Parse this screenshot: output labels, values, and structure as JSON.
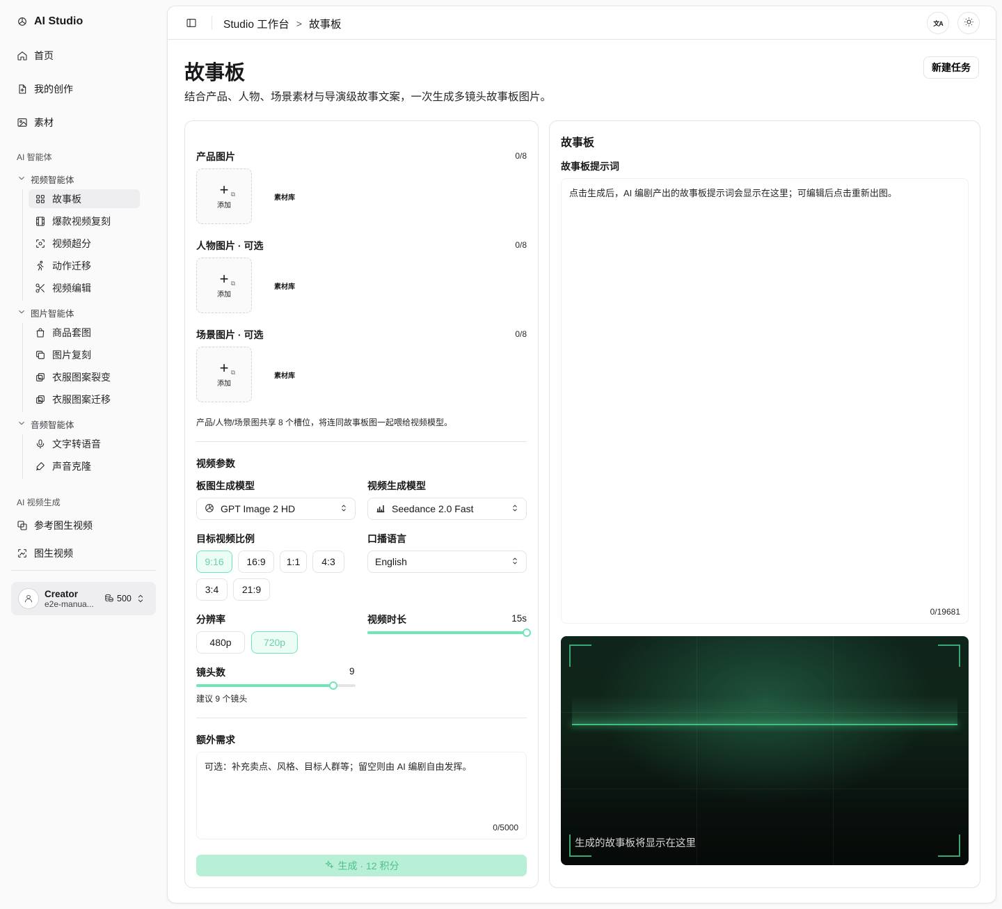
{
  "app": {
    "name": "AI Studio"
  },
  "nav": {
    "home": "首页",
    "my_creations": "我的创作",
    "assets": "素材"
  },
  "sections": {
    "ai_agents": "AI 智能体",
    "ai_video": "AI 视频生成"
  },
  "groups": {
    "video": {
      "label": "视频智能体",
      "items": [
        "故事板",
        "爆款视频复刻",
        "视频超分",
        "动作迁移",
        "视频编辑"
      ]
    },
    "image": {
      "label": "图片智能体",
      "items": [
        "商品套图",
        "图片复刻",
        "衣服图案裂变",
        "衣服图案迁移"
      ]
    },
    "audio": {
      "label": "音频智能体",
      "items": [
        "文字转语音",
        "声音克隆"
      ]
    }
  },
  "video_gen": {
    "items": [
      "参考图生视频",
      "图生视频"
    ]
  },
  "user": {
    "name": "Creator",
    "email": "e2e-manua...",
    "credits": "500"
  },
  "header": {
    "breadcrumb_root": "Studio 工作台",
    "breadcrumb_sep": ">",
    "breadcrumb_current": "故事板",
    "lang_icon_text": "文A"
  },
  "page": {
    "title": "故事板",
    "subtitle": "结合产品、人物、场景素材与导演级故事文案，一次生成多镜头故事板图片。",
    "new_task": "新建任务"
  },
  "form": {
    "product": {
      "label": "产品图片",
      "count": "0/8"
    },
    "person": {
      "label": "人物图片 · 可选",
      "count": "0/8"
    },
    "scene": {
      "label": "场景图片 · 可选",
      "count": "0/8"
    },
    "add_label": "添加",
    "library_label": "素材库",
    "slots_note": "产品/人物/场景图共享 8 个槽位，将连同故事板图一起喂给视频模型。",
    "video_params": "视频参数",
    "board_model_label": "板图生成模型",
    "board_model_value": "GPT Image 2 HD",
    "video_model_label": "视频生成模型",
    "video_model_value": "Seedance 2.0 Fast",
    "ratio_label": "目标视频比例",
    "ratios": [
      "9:16",
      "16:9",
      "1:1",
      "4:3",
      "3:4",
      "21:9"
    ],
    "ratio_selected": "9:16",
    "language_label": "口播语言",
    "language_value": "English",
    "resolution_label": "分辨率",
    "resolutions": [
      "480p",
      "720p"
    ],
    "resolution_selected": "720p",
    "duration_label": "视频时长",
    "duration_value": "15s",
    "duration_fraction": 1.0,
    "shots_label": "镜头数",
    "shots_value": "9",
    "shots_fraction": 0.86,
    "shots_hint": "建议 9 个镜头",
    "extra_label": "额外需求",
    "extra_placeholder": "可选：补充卖点、风格、目标人群等；留空则由 AI 编剧自由发挥。",
    "extra_count": "0/5000",
    "generate_label": "生成 · 12 积分"
  },
  "right": {
    "title": "故事板",
    "prompt_label": "故事板提示词",
    "prompt_placeholder": "点击生成后，AI 编剧产出的故事板提示词会显示在这里；可编辑后点击重新出图。",
    "prompt_count": "0/19681",
    "preview_label": "生成的故事板将显示在这里"
  },
  "colors": {
    "accent": "#6ee7b7",
    "accent_soft": "#b7f0d6",
    "preview_line": "#3fbf80"
  }
}
